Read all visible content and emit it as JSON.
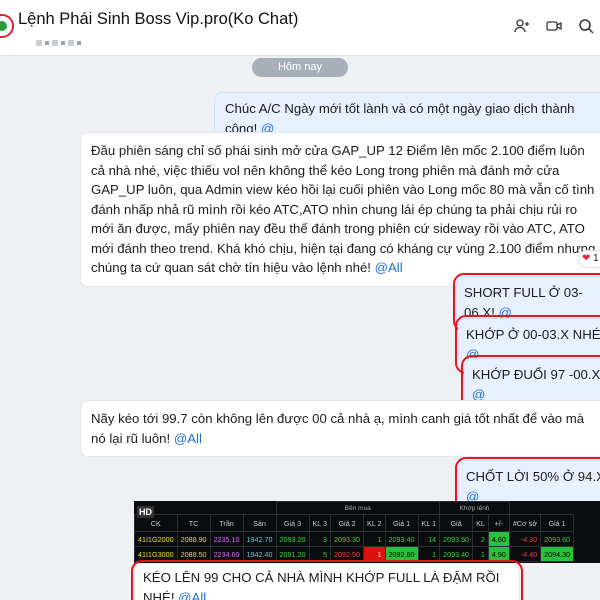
{
  "header": {
    "title": "Lệnh Phái Sinh Boss Vip.pro(Ko Chat)",
    "icons": [
      "add-member-icon",
      "video-call-icon",
      "search-icon"
    ]
  },
  "date_chip": "Hôm nay",
  "messages": [
    {
      "text": "Chúc A/C Ngày mới tốt lành và có một ngày giao dịch thành công! ",
      "mention": "@",
      "side": "mine"
    },
    {
      "text": "Đầu phiên sáng chỉ số phái sinh mở cửa GAP_UP 12 Điểm lên mốc 2.100 điểm luôn cả nhà nhé, việc thiếu vol nên không thể kéo Long trong phiên mà đánh mở cửa GAP_UP luôn, qua Admin view kéo hồi lại cuối phiên vào Long mốc 80 mà vẫn cố tình đánh nhấp nhả rũ mình rồi kéo ATC,ATO nhìn chung lái ép chúng ta phải chịu rủi ro mới ăn được, mấy phiên nay đều thế đánh trong phiên cứ sideway rồi vào ATC, ATO mới đánh theo trend. Khá khó chịu, hiện tại đang có kháng cự vùng 2.100 điểm nhưng chúng ta cứ quan sát chờ tín hiệu vào lệnh nhé! ",
      "mention": "@All",
      "side": "theirs",
      "reaction": {
        "icon": "❤",
        "count": "1"
      }
    },
    {
      "text": "SHORT FULL Ở 03-06.X! ",
      "mention": "@",
      "side": "mine"
    },
    {
      "text": "KHỚP Ở 00-03.X NHÉ! ",
      "mention": "@",
      "side": "mine"
    },
    {
      "text": "KHỚP ĐUỔI 97 -00.X! ",
      "mention": "@",
      "side": "mine"
    },
    {
      "text": "Nãy kéo tới 99.7 còn không lên được 00 cả nhà ạ, mình canh giá tốt nhất để vào mà nó lại rũ luôn! ",
      "mention": "@All",
      "side": "theirs"
    },
    {
      "text": "CHỐT LỜI 50% Ở 94.X! ",
      "mention": "@",
      "side": "mine"
    },
    {
      "text": "KÉO LÊN 99 CHO CẢ NHÀ MÌNH KHỚP FULL LÀ ĐẬM RỒI NHÉ! ",
      "mention": "@All",
      "side": "theirs"
    }
  ],
  "board": {
    "badge": "HD",
    "group_headers": [
      "Bên mua",
      "Khớp lệnh"
    ],
    "columns": [
      "CK",
      "TC",
      "Trần",
      "Sàn",
      "Giá 3",
      "KL 3",
      "Giá 2",
      "KL 2",
      "Giá 1",
      "KL 1",
      "Giá",
      "KL",
      "+/-",
      "#Cơ sở",
      "Giá 1"
    ],
    "rows": [
      [
        "41I1G2000",
        "2088.90",
        "2235.10",
        "1942.70",
        "2093.20",
        "3",
        "2093.30",
        "1",
        "2093.40",
        "14",
        "2093.50",
        "2",
        "4.60",
        "-4.30",
        "2093.60"
      ],
      [
        "41I1G3000",
        "2088.50",
        "2234.60",
        "1942.40",
        "2091.20",
        "5",
        "2092.50",
        "1",
        "2092.60",
        "1",
        "2093.40",
        "1",
        "4.90",
        "-4.40",
        "2094.30"
      ]
    ]
  },
  "colors": {
    "mine_bubble": "#e6f0ff",
    "theirs_bubble": "#ffffff",
    "mention": "#1f6fd6",
    "highlight_border": "#e3151d"
  }
}
